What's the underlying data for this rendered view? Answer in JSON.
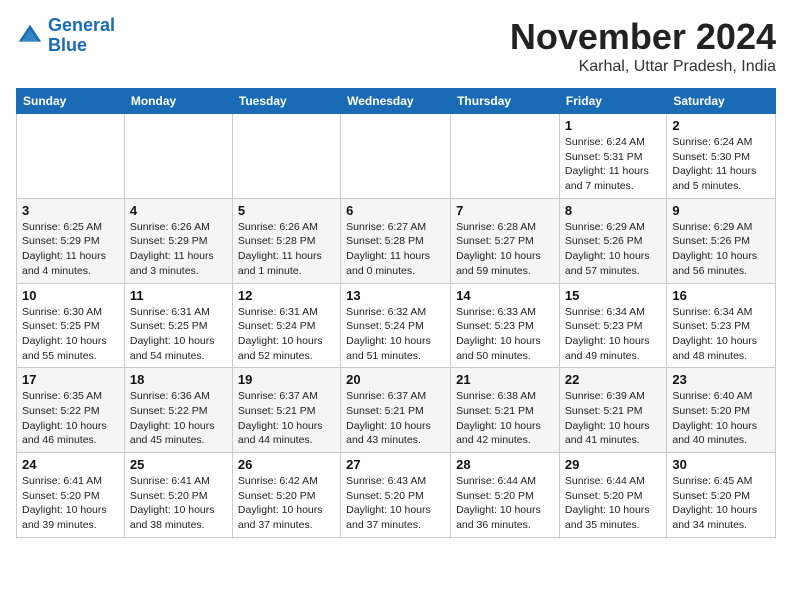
{
  "header": {
    "logo_line1": "General",
    "logo_line2": "Blue",
    "month_title": "November 2024",
    "location": "Karhal, Uttar Pradesh, India"
  },
  "weekdays": [
    "Sunday",
    "Monday",
    "Tuesday",
    "Wednesday",
    "Thursday",
    "Friday",
    "Saturday"
  ],
  "weeks": [
    [
      {
        "day": "",
        "detail": ""
      },
      {
        "day": "",
        "detail": ""
      },
      {
        "day": "",
        "detail": ""
      },
      {
        "day": "",
        "detail": ""
      },
      {
        "day": "",
        "detail": ""
      },
      {
        "day": "1",
        "detail": "Sunrise: 6:24 AM\nSunset: 5:31 PM\nDaylight: 11 hours and 7 minutes."
      },
      {
        "day": "2",
        "detail": "Sunrise: 6:24 AM\nSunset: 5:30 PM\nDaylight: 11 hours and 5 minutes."
      }
    ],
    [
      {
        "day": "3",
        "detail": "Sunrise: 6:25 AM\nSunset: 5:29 PM\nDaylight: 11 hours and 4 minutes."
      },
      {
        "day": "4",
        "detail": "Sunrise: 6:26 AM\nSunset: 5:29 PM\nDaylight: 11 hours and 3 minutes."
      },
      {
        "day": "5",
        "detail": "Sunrise: 6:26 AM\nSunset: 5:28 PM\nDaylight: 11 hours and 1 minute."
      },
      {
        "day": "6",
        "detail": "Sunrise: 6:27 AM\nSunset: 5:28 PM\nDaylight: 11 hours and 0 minutes."
      },
      {
        "day": "7",
        "detail": "Sunrise: 6:28 AM\nSunset: 5:27 PM\nDaylight: 10 hours and 59 minutes."
      },
      {
        "day": "8",
        "detail": "Sunrise: 6:29 AM\nSunset: 5:26 PM\nDaylight: 10 hours and 57 minutes."
      },
      {
        "day": "9",
        "detail": "Sunrise: 6:29 AM\nSunset: 5:26 PM\nDaylight: 10 hours and 56 minutes."
      }
    ],
    [
      {
        "day": "10",
        "detail": "Sunrise: 6:30 AM\nSunset: 5:25 PM\nDaylight: 10 hours and 55 minutes."
      },
      {
        "day": "11",
        "detail": "Sunrise: 6:31 AM\nSunset: 5:25 PM\nDaylight: 10 hours and 54 minutes."
      },
      {
        "day": "12",
        "detail": "Sunrise: 6:31 AM\nSunset: 5:24 PM\nDaylight: 10 hours and 52 minutes."
      },
      {
        "day": "13",
        "detail": "Sunrise: 6:32 AM\nSunset: 5:24 PM\nDaylight: 10 hours and 51 minutes."
      },
      {
        "day": "14",
        "detail": "Sunrise: 6:33 AM\nSunset: 5:23 PM\nDaylight: 10 hours and 50 minutes."
      },
      {
        "day": "15",
        "detail": "Sunrise: 6:34 AM\nSunset: 5:23 PM\nDaylight: 10 hours and 49 minutes."
      },
      {
        "day": "16",
        "detail": "Sunrise: 6:34 AM\nSunset: 5:23 PM\nDaylight: 10 hours and 48 minutes."
      }
    ],
    [
      {
        "day": "17",
        "detail": "Sunrise: 6:35 AM\nSunset: 5:22 PM\nDaylight: 10 hours and 46 minutes."
      },
      {
        "day": "18",
        "detail": "Sunrise: 6:36 AM\nSunset: 5:22 PM\nDaylight: 10 hours and 45 minutes."
      },
      {
        "day": "19",
        "detail": "Sunrise: 6:37 AM\nSunset: 5:21 PM\nDaylight: 10 hours and 44 minutes."
      },
      {
        "day": "20",
        "detail": "Sunrise: 6:37 AM\nSunset: 5:21 PM\nDaylight: 10 hours and 43 minutes."
      },
      {
        "day": "21",
        "detail": "Sunrise: 6:38 AM\nSunset: 5:21 PM\nDaylight: 10 hours and 42 minutes."
      },
      {
        "day": "22",
        "detail": "Sunrise: 6:39 AM\nSunset: 5:21 PM\nDaylight: 10 hours and 41 minutes."
      },
      {
        "day": "23",
        "detail": "Sunrise: 6:40 AM\nSunset: 5:20 PM\nDaylight: 10 hours and 40 minutes."
      }
    ],
    [
      {
        "day": "24",
        "detail": "Sunrise: 6:41 AM\nSunset: 5:20 PM\nDaylight: 10 hours and 39 minutes."
      },
      {
        "day": "25",
        "detail": "Sunrise: 6:41 AM\nSunset: 5:20 PM\nDaylight: 10 hours and 38 minutes."
      },
      {
        "day": "26",
        "detail": "Sunrise: 6:42 AM\nSunset: 5:20 PM\nDaylight: 10 hours and 37 minutes."
      },
      {
        "day": "27",
        "detail": "Sunrise: 6:43 AM\nSunset: 5:20 PM\nDaylight: 10 hours and 37 minutes."
      },
      {
        "day": "28",
        "detail": "Sunrise: 6:44 AM\nSunset: 5:20 PM\nDaylight: 10 hours and 36 minutes."
      },
      {
        "day": "29",
        "detail": "Sunrise: 6:44 AM\nSunset: 5:20 PM\nDaylight: 10 hours and 35 minutes."
      },
      {
        "day": "30",
        "detail": "Sunrise: 6:45 AM\nSunset: 5:20 PM\nDaylight: 10 hours and 34 minutes."
      }
    ]
  ]
}
